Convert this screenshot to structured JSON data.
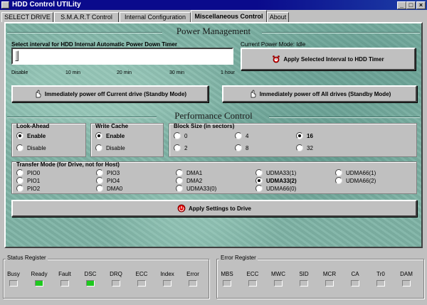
{
  "window": {
    "title": "HDD Control UTILity",
    "minimize": "_",
    "maximize": "□",
    "close": "×"
  },
  "tabs": [
    {
      "label": "SELECT DRIVE"
    },
    {
      "label": "S.M.A.R.T Control"
    },
    {
      "label": "Internal Configuration"
    },
    {
      "label": "Miscellaneous Control"
    },
    {
      "label": "About"
    }
  ],
  "power": {
    "section_title": "Power Management",
    "interval_label": "Select interval for HDD Internal  Automatic Power Down Timer",
    "current_mode_label": "Current Power Mode: Idle",
    "ticks": [
      "Disable",
      "10 min",
      "20 min",
      "30 min",
      "1 hour"
    ],
    "slider_value": 0,
    "apply_button": "Apply Selected Interval to HDD Timer",
    "standby_current": "Immediately power off Current drive (Standby Mode)",
    "standby_all": "Immediately power off All drives (Standby Mode)"
  },
  "performance": {
    "section_title": "Performance Control",
    "lookahead": {
      "title": "Look-Ahead",
      "options": [
        "Enable",
        "Disable"
      ],
      "selected": "Enable"
    },
    "writecache": {
      "title": "Write Cache",
      "options": [
        "Enable",
        "Disable"
      ],
      "selected": "Enable"
    },
    "blocksize": {
      "title": "Block Size (in sectors)",
      "options": [
        "0",
        "4",
        "16",
        "2",
        "8",
        "32"
      ],
      "selected": "16"
    },
    "transfer": {
      "title": "Transfer Mode (for Drive, not for Host)",
      "options": [
        "PIO0",
        "PIO3",
        "DMA1",
        "UDMA33(1)",
        "UDMA66(1)",
        "PIO1",
        "PIO4",
        "DMA2",
        "UDMA33(2)",
        "UDMA66(2)",
        "PIO2",
        "DMA0",
        "UDMA33(0)",
        "UDMA66(0)"
      ],
      "selected": "UDMA33(2)"
    },
    "apply_button": "Apply Settings to Drive"
  },
  "status_register": {
    "title": "Status Register",
    "bits": [
      {
        "label": "Busy",
        "on": false
      },
      {
        "label": "Ready",
        "on": true
      },
      {
        "label": "Fault",
        "on": false
      },
      {
        "label": "DSC",
        "on": true
      },
      {
        "label": "DRQ",
        "on": false
      },
      {
        "label": "ECC",
        "on": false
      },
      {
        "label": "Index",
        "on": false
      },
      {
        "label": "Error",
        "on": false
      }
    ]
  },
  "error_register": {
    "title": "Error Register",
    "bits": [
      {
        "label": "MBS",
        "on": false
      },
      {
        "label": "ECC",
        "on": false
      },
      {
        "label": "MWC",
        "on": false
      },
      {
        "label": "SID",
        "on": false
      },
      {
        "label": "MCR",
        "on": false
      },
      {
        "label": "CA",
        "on": false
      },
      {
        "label": "Tr0",
        "on": false
      },
      {
        "label": "DAM",
        "on": false
      }
    ]
  },
  "colors": {
    "titlebar": "#0a0a8c",
    "panel_bg": "#7fb4a6",
    "led_on": "#1ec81e",
    "face": "#c0c0c0"
  },
  "icons": {
    "timer": "alarm-clock-icon",
    "hand": "hand-pointer-icon",
    "apply": "power-stop-icon"
  }
}
